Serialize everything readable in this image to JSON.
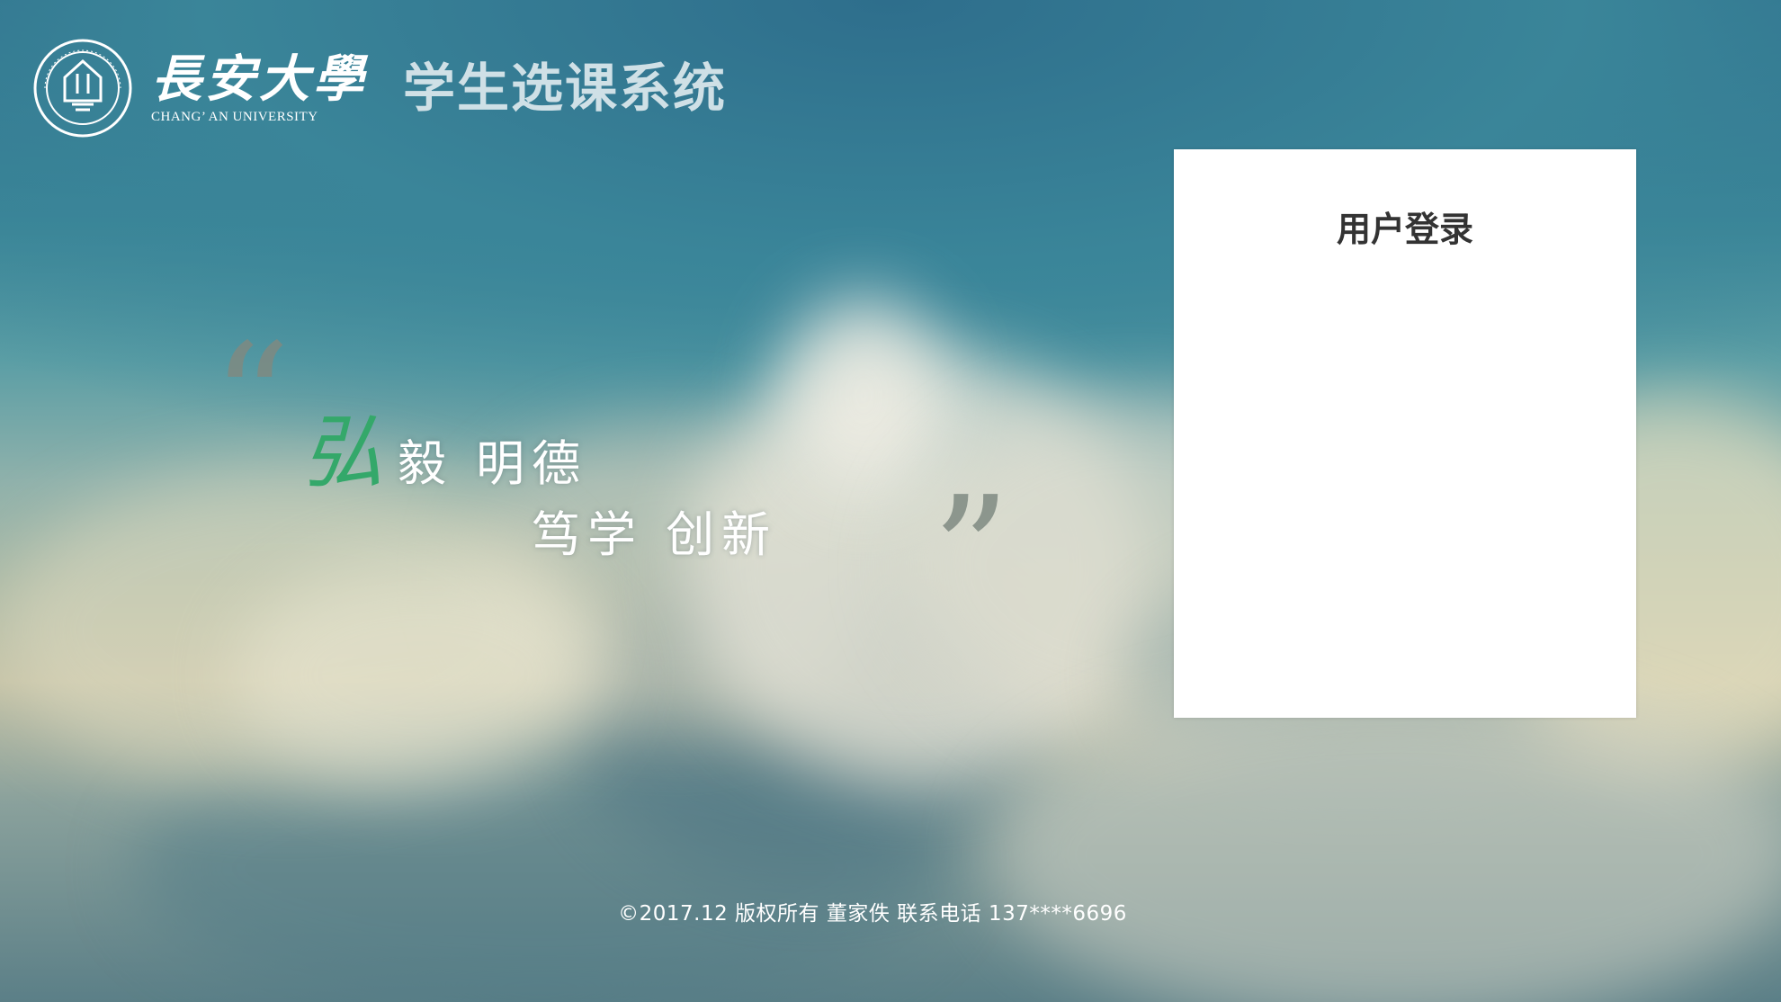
{
  "header": {
    "university_name_cn": "長安大學",
    "university_name_en": "CHANG’ AN UNIVERSITY",
    "emblem_icon": "university-emblem-icon",
    "system_title": "学生选课系统"
  },
  "slogan": {
    "quote_open": "“",
    "highlight_char": "弘",
    "line1_rest": "毅  明德",
    "line2": "笃学  创新",
    "quote_close": "”",
    "highlight_color": "#34a86a"
  },
  "login": {
    "title": "用户登录"
  },
  "footer": {
    "text": "©2017.12 版权所有 董家佚 联系电话 137****6696"
  },
  "colors": {
    "title_text": "#cfe0e6",
    "panel_bg": "#ffffff",
    "footer_text": "#ffffff"
  }
}
